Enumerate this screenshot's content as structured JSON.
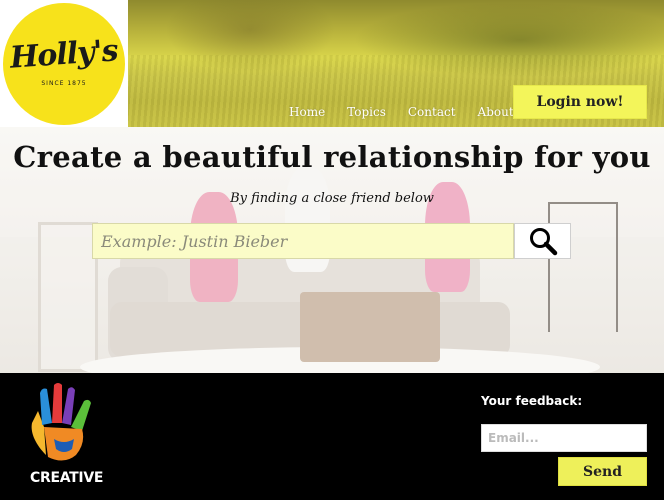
{
  "header": {
    "logo": {
      "name": "Holly's",
      "since": "SINCE 1875",
      "circle_color": "#f7e21b"
    },
    "nav": [
      {
        "label": "Home"
      },
      {
        "label": "Topics"
      },
      {
        "label": "Contact"
      },
      {
        "label": "About"
      }
    ],
    "login_label": "Login now!",
    "accent_color": "#f3f55a"
  },
  "hero": {
    "title": "Create a beautiful relationship for you",
    "subtitle": "By finding a close friend below",
    "search": {
      "placeholder": "Example: Justin Bieber",
      "value": "",
      "button_icon": "search-icon"
    }
  },
  "footer": {
    "brand_label": "CREATIVE",
    "brand_icon": "hand-logo-icon",
    "feedback_label": "Your feedback:",
    "email_placeholder": "Email...",
    "send_label": "Send"
  }
}
